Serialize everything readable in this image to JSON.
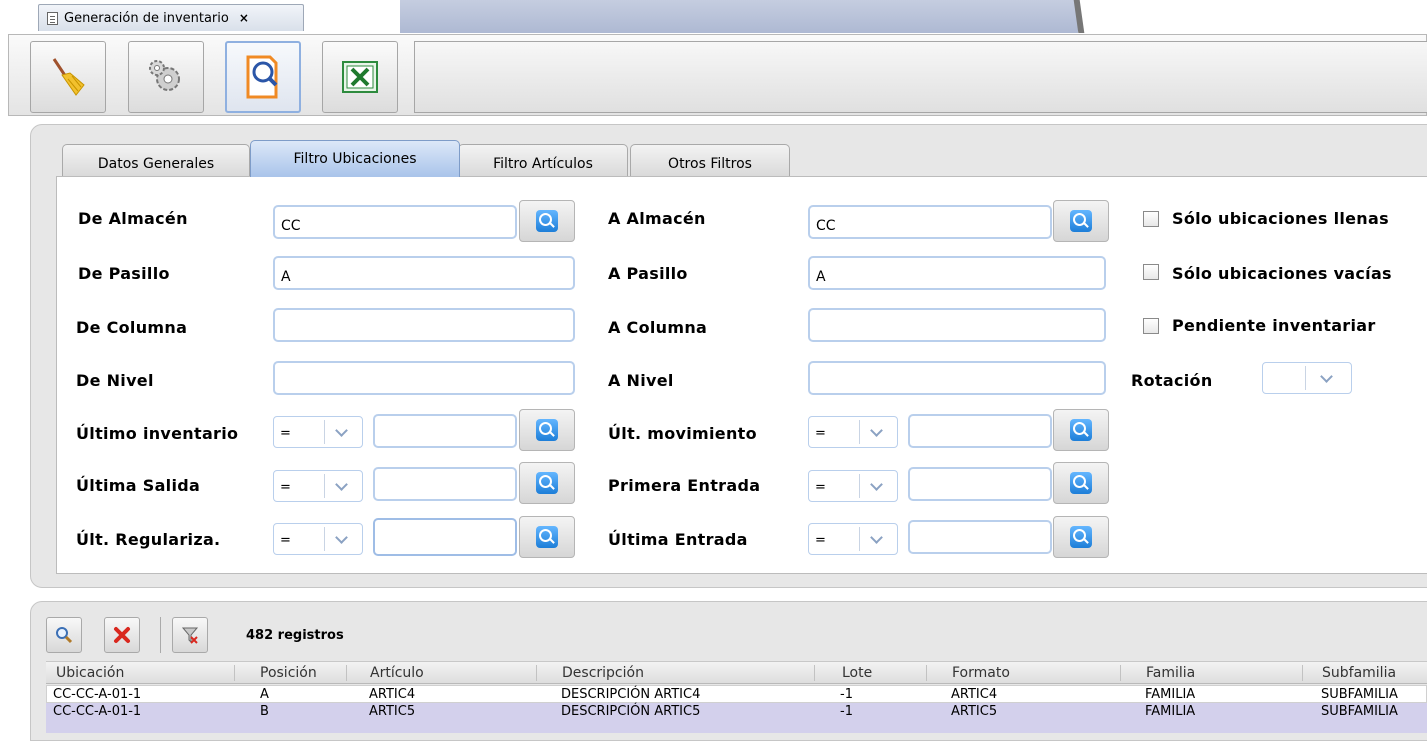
{
  "document_tab": {
    "title": "Generación de inventario",
    "close": "×"
  },
  "toolbar": {
    "buttons": [
      {
        "icon": "broom-icon"
      },
      {
        "icon": "gears-icon"
      },
      {
        "icon": "search-document-icon"
      },
      {
        "icon": "excel-icon"
      }
    ]
  },
  "filter_tabs": [
    "Datos Generales",
    "Filtro Ubicaciones",
    "Filtro Artículos",
    "Otros Filtros"
  ],
  "active_filter_tab": "Filtro Ubicaciones",
  "form": {
    "de_almacen": {
      "label": "De Almacén",
      "value": "CC"
    },
    "a_almacen": {
      "label": "A Almacén",
      "value": "CC"
    },
    "de_pasillo": {
      "label": "De Pasillo",
      "value": "A"
    },
    "a_pasillo": {
      "label": "A Pasillo",
      "value": "A"
    },
    "de_columna": {
      "label": "De Columna",
      "value": ""
    },
    "a_columna": {
      "label": "A Columna",
      "value": ""
    },
    "de_nivel": {
      "label": "De Nivel",
      "value": ""
    },
    "a_nivel": {
      "label": "A Nivel",
      "value": ""
    },
    "ultimo_inventario": {
      "label": "Último inventario",
      "operator": "=",
      "value": ""
    },
    "ult_movimiento": {
      "label": "Últ. movimiento",
      "operator": "=",
      "value": ""
    },
    "ultima_salida": {
      "label": "Última Salida",
      "operator": "=",
      "value": ""
    },
    "primera_entrada": {
      "label": "Primera Entrada",
      "operator": "=",
      "value": ""
    },
    "ult_regulariza": {
      "label": "Últ. Regulariza.",
      "operator": "=",
      "value": ""
    },
    "ultima_entrada": {
      "label": "Última Entrada",
      "operator": "=",
      "value": ""
    },
    "solo_llenas": {
      "label": "Sólo ubicaciones llenas",
      "checked": false
    },
    "solo_vacias": {
      "label": "Sólo ubicaciones vacías",
      "checked": false
    },
    "pendiente": {
      "label": "Pendiente inventariar",
      "checked": false
    },
    "rotacion": {
      "label": "Rotación",
      "value": ""
    }
  },
  "grid": {
    "count_text": "482 registros",
    "columns": [
      "Ubicación",
      "Posición",
      "Artículo",
      "Descripción",
      "Lote",
      "Formato",
      "Familia",
      "Subfamilia"
    ],
    "rows": [
      [
        "CC-CC-A-01-1",
        "A",
        "ARTIC4",
        "DESCRIPCIÓN ARTIC4",
        "-1",
        "ARTIC4",
        "FAMILIA",
        "SUBFAMILIA"
      ],
      [
        "CC-CC-A-01-1",
        "B",
        "ARTIC5",
        "DESCRIPCIÓN ARTIC5",
        "-1",
        "ARTIC5",
        "FAMILIA",
        "SUBFAMILIA"
      ]
    ],
    "selected_row_color": "#d3d0ec"
  }
}
